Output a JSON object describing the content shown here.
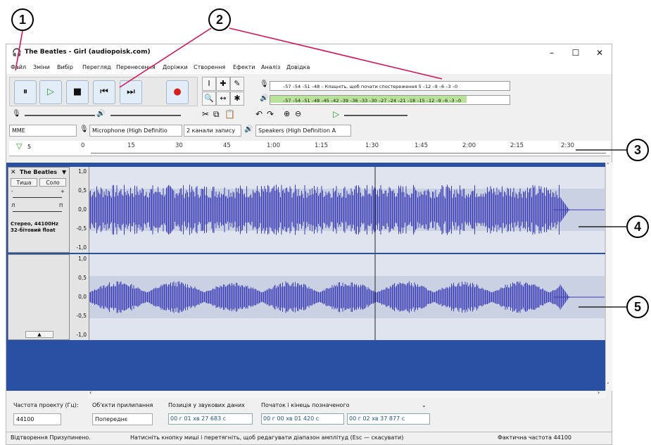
{
  "callouts": [
    "1",
    "2",
    "3",
    "4",
    "5"
  ],
  "window": {
    "title": "The Beatles - Girl (audiopoisk.com)",
    "minimize": "–",
    "maximize": "☐",
    "close": "✕"
  },
  "menu": [
    "Файл",
    "Зміни",
    "Вибір",
    "Перегляд",
    "Перенесення",
    "Доріжки",
    "Створення",
    "Ефекти",
    "Аналіз",
    "Довідка"
  ],
  "transport": {
    "pause": "⏸",
    "play": "▷",
    "stop": "■",
    "skip_start": "⏮",
    "skip_end": "⏭",
    "record": "●"
  },
  "tools": {
    "select": "I",
    "envelope": "✚",
    "draw": "✎",
    "zoom": "🔍",
    "timeshift": "↔",
    "multi": "✱"
  },
  "meters": {
    "record_scale": "–57 –54 –51 –48 – Клацніть, щоб почати спостереження 5 –12 –9 –6 –3 –0",
    "play_scale": "–57 –54 –51 –48 –45 –42 –39 –36 –33 –30 –27 –24 –21 –18 –15 –12 –9 –6 –3 –0",
    "play_fill_fraction": 0.82
  },
  "devices": {
    "host": "MME",
    "mic": "Microphone (High Definitio",
    "channels": "2 канали запису",
    "speakers": "Speakers (High Definition A"
  },
  "timeline": {
    "start_value": "5",
    "ticks": [
      "0",
      "15",
      "30",
      "45",
      "1:00",
      "1:15",
      "1:30",
      "1:45",
      "2:00",
      "2:15",
      "2:30"
    ]
  },
  "track": {
    "name": "The Beatles",
    "mute": "Тиша",
    "solo": "Соло",
    "gain_minus": "-",
    "gain_plus": "+",
    "pan_left": "Л",
    "pan_right": "П",
    "info": "Стерео, 44100Hz 32-бітовий float",
    "scale": [
      "1,0",
      "0,5",
      "0,0",
      "-0,5",
      "-1,0"
    ]
  },
  "bottom": {
    "rate_label": "Частота проекту (Гц):",
    "rate_value": "44100",
    "snap_label": "Об'єкти прилипання",
    "snap_value": "Попереднє",
    "pos_label": "Позиція у звукових даних",
    "pos_value": "00 г 01 хв 27 683 с",
    "sel_label": "Початок і кінець позначеного",
    "sel_start": "00 г 00 хв 01 420 с",
    "sel_end": "00 г 02 хв 37 877 с"
  },
  "status": {
    "left": "Відтворення Призупинено.",
    "middle": "Натисніть кнопку миші і перетягніть, щоб редагувати діапазон амплітуд (Esc — скасувати)",
    "right": "Фактична частота 44100"
  }
}
